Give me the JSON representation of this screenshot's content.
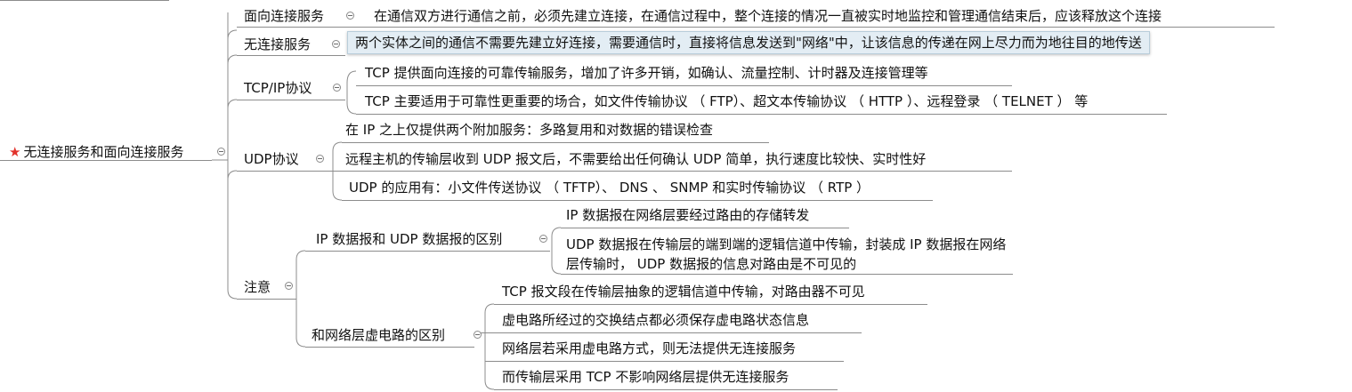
{
  "root": {
    "label": "无连接服务和面向连接服务",
    "icon": "star-icon"
  },
  "branches": [
    {
      "label": "面向连接服务",
      "children": [
        "在通信双方进行通信之前，必须先建立连接，在通信过程中，整个连接的情况一直被实时地监控和管理通信结束后，应该释放这个连接"
      ]
    },
    {
      "label": "无连接服务",
      "children": [
        "两个实体之间的通信不需要先建立好连接，需要通信时，直接将信息发送到\"网络\"中，让该信息的传递在网上尽力而为地往目的地传送"
      ]
    },
    {
      "label": "TCP/IP协议",
      "children": [
        "TCP 提供面向连接的可靠传输服务，增加了许多开销，如确认、流量控制、计时器及连接管理等",
        "TCP 主要适用于可靠性更重要的场合，如文件传输协议 （ FTP）、超文本传输协议 （ HTTP ）、远程登录 （ TELNET ） 等"
      ]
    },
    {
      "label": "UDP协议",
      "children": [
        "在 IP 之上仅提供两个附加服务：多路复用和对数据的错误检查",
        "远程主机的传输层收到 UDP 报文后，不需要给出任何确认 UDP 简单，执行速度比较快、实时性好",
        "UDP 的应用有：小文件传送协议 （ TFTP）、 DNS 、 SNMP 和实时传输协议 （ RTP ）"
      ]
    },
    {
      "label": "注意",
      "children": [
        {
          "label": "IP 数据报和 UDP 数据报的区别",
          "children": [
            "IP 数据报在网络层要经过路由的存储转发",
            "UDP 数据报在传输层的端到端的逻辑信道中传输，封装成 IP 数据报在网络层传输时， UDP 数据报的信息对路由是不可见的"
          ]
        },
        {
          "label": "和网络层虚电路的区别",
          "children": [
            "TCP 报文段在传输层抽象的逻辑信道中传输，对路由器不可见",
            "虚电路所经过的交换结点都必须保存虚电路状态信息",
            "网络层若采用虚电路方式，则无法提供无连接服务",
            "而传输层采用 TCP 不影响网络层提供无连接服务"
          ]
        }
      ]
    }
  ]
}
